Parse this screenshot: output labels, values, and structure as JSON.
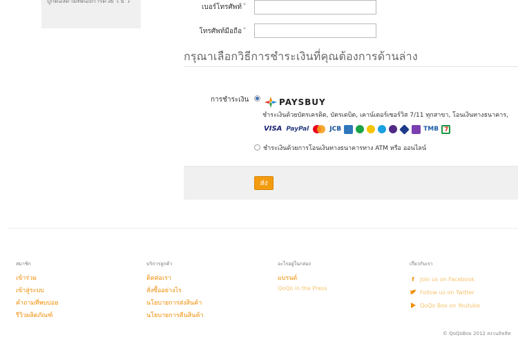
{
  "left_panel": {
    "text": "ถูกต้องตามที่ต้องการด้วย ใ ธ วิ"
  },
  "form": {
    "phone_label": "เบอร์โทรศัพท์",
    "phone_value": "",
    "mobile_label": "โทรศัพท์มือถือ",
    "mobile_value": "",
    "required_mark": "*"
  },
  "payment": {
    "section_title": "กรุณาเลือกวิธีการชำระเงินที่คุณต้องการด้านล่าง",
    "label": "การชำระเงิน",
    "paysbuy_logo_text": "PAYSBUY",
    "paysbuy_desc": "ชำระเงินด้วยบัตรเครดิต, บัตรเดบิต, เคาน์เตอร์เซอร์วิส 7/11 ทุกสาขา, โอนเงินทางธนาคาร,",
    "cards": [
      {
        "name": "VISA",
        "color": "#1a1f71"
      },
      {
        "name": "PayPal",
        "color": "#253b80"
      },
      {
        "name": "mastercard-icon",
        "color": "#eb001b"
      },
      {
        "name": "JCB",
        "color": "#0e4c96"
      },
      {
        "name": "amex-icon",
        "color": "#2e77bb"
      },
      {
        "name": "kasikorn-icon",
        "color": "#1ba345"
      },
      {
        "name": "krungsri-icon",
        "color": "#f5c400"
      },
      {
        "name": "ktb-icon",
        "color": "#1ba0e2"
      },
      {
        "name": "scb-icon",
        "color": "#4e2a84"
      },
      {
        "name": "bangkok-bank-icon",
        "color": "#1e3a8a"
      },
      {
        "name": "tmb-icon",
        "color": "#1f5ba8"
      },
      {
        "name": "seven-eleven-icon",
        "color": "#e0301e"
      }
    ],
    "atm_option": "ชำระเงินด้วยการโอนเงินทางธนาคารทาง ATM หรือ ออนไลน์",
    "submit_label": "ส่ง"
  },
  "footer": {
    "members": {
      "heading": "สมาชิก",
      "links": [
        "เข้าร่วม",
        "เข้าสู่ระบบ",
        "คำถามที่พบบ่อย",
        "รีวิวผลิตภัณฑ์"
      ]
    },
    "service": {
      "heading": "บริการลูกค้า",
      "links": [
        "ติดต่อเรา",
        "สั่งซื้ออย่างไร",
        "นโยบายการส่งสินค้า",
        "นโยบายการคืนสินค้า"
      ]
    },
    "inside": {
      "heading": "อะไรอยู่ในกล่อง",
      "links": [
        "แบรนด์",
        "QoQo in the Press"
      ]
    },
    "follow": {
      "heading": "เกี่ยวกับเรา",
      "links": [
        "Join us on Facebook",
        "Follow us on Twitter",
        "QoQo Box on Youtube"
      ]
    },
    "copyright": "© QoQoBox 2012 สงวนลิขสิท"
  },
  "colors": {
    "accent": "#f08c00",
    "button": "#f39b10",
    "panel": "#f0f0f0"
  }
}
